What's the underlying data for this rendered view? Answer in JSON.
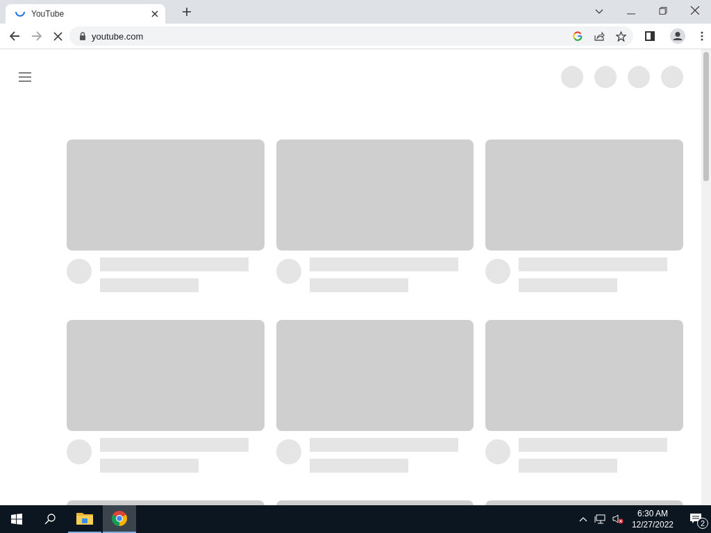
{
  "tabs": [
    {
      "title": "YouTube",
      "selected": true,
      "loading": true
    }
  ],
  "address_bar": {
    "url": "youtube.com",
    "loading": true
  },
  "taskbar": {
    "apps": [
      {
        "kind": "explorer",
        "selected": false
      },
      {
        "kind": "chrome",
        "selected": true
      }
    ],
    "time": "6:30 AM",
    "date": "12/27/2022",
    "notifications": "2"
  }
}
